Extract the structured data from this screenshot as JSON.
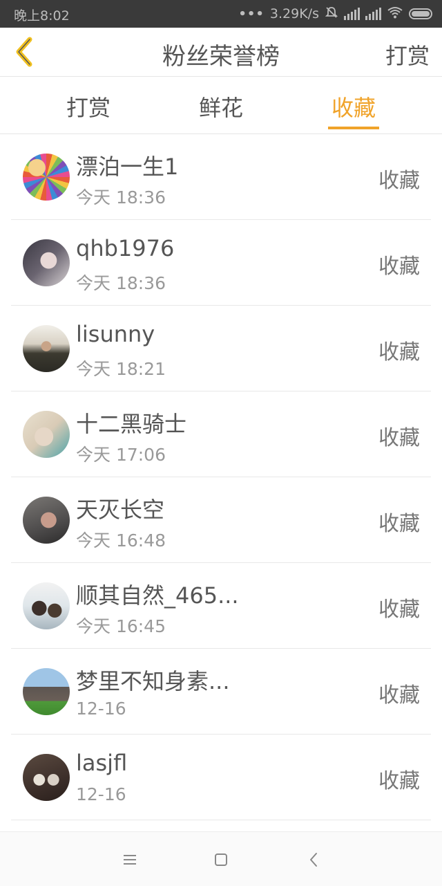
{
  "status_bar": {
    "time": "晚上8:02",
    "network_speed": "3.29K/s",
    "more_indicator": "•••"
  },
  "header": {
    "back_icon": "chevron-left-icon",
    "title": "粉丝荣誉榜",
    "action_label": "打赏"
  },
  "tabs": [
    {
      "label": "打赏",
      "active": false
    },
    {
      "label": "鲜花",
      "active": false
    },
    {
      "label": "收藏",
      "active": true
    }
  ],
  "accent_color": "#f0a32a",
  "list": [
    {
      "name": "漂泊一生1",
      "time": "今天 18:36",
      "type": "收藏"
    },
    {
      "name": "qhb1976",
      "time": "今天 18:36",
      "type": "收藏"
    },
    {
      "name": "lisunny",
      "time": "今天 18:21",
      "type": "收藏"
    },
    {
      "name": "十二黑骑士",
      "time": "今天 17:06",
      "type": "收藏"
    },
    {
      "name": "天灭长空",
      "time": "今天 16:48",
      "type": "收藏"
    },
    {
      "name": "顺其自然_465...",
      "time": "今天 16:45",
      "type": "收藏"
    },
    {
      "name": "梦里不知身素...",
      "time": "12-16",
      "type": "收藏"
    },
    {
      "name": "lasjfl",
      "time": "12-16",
      "type": "收藏"
    }
  ],
  "nav_bar": {
    "menu_icon": "menu-icon",
    "home_icon": "home-square-icon",
    "back_icon": "back-chevron-icon"
  }
}
